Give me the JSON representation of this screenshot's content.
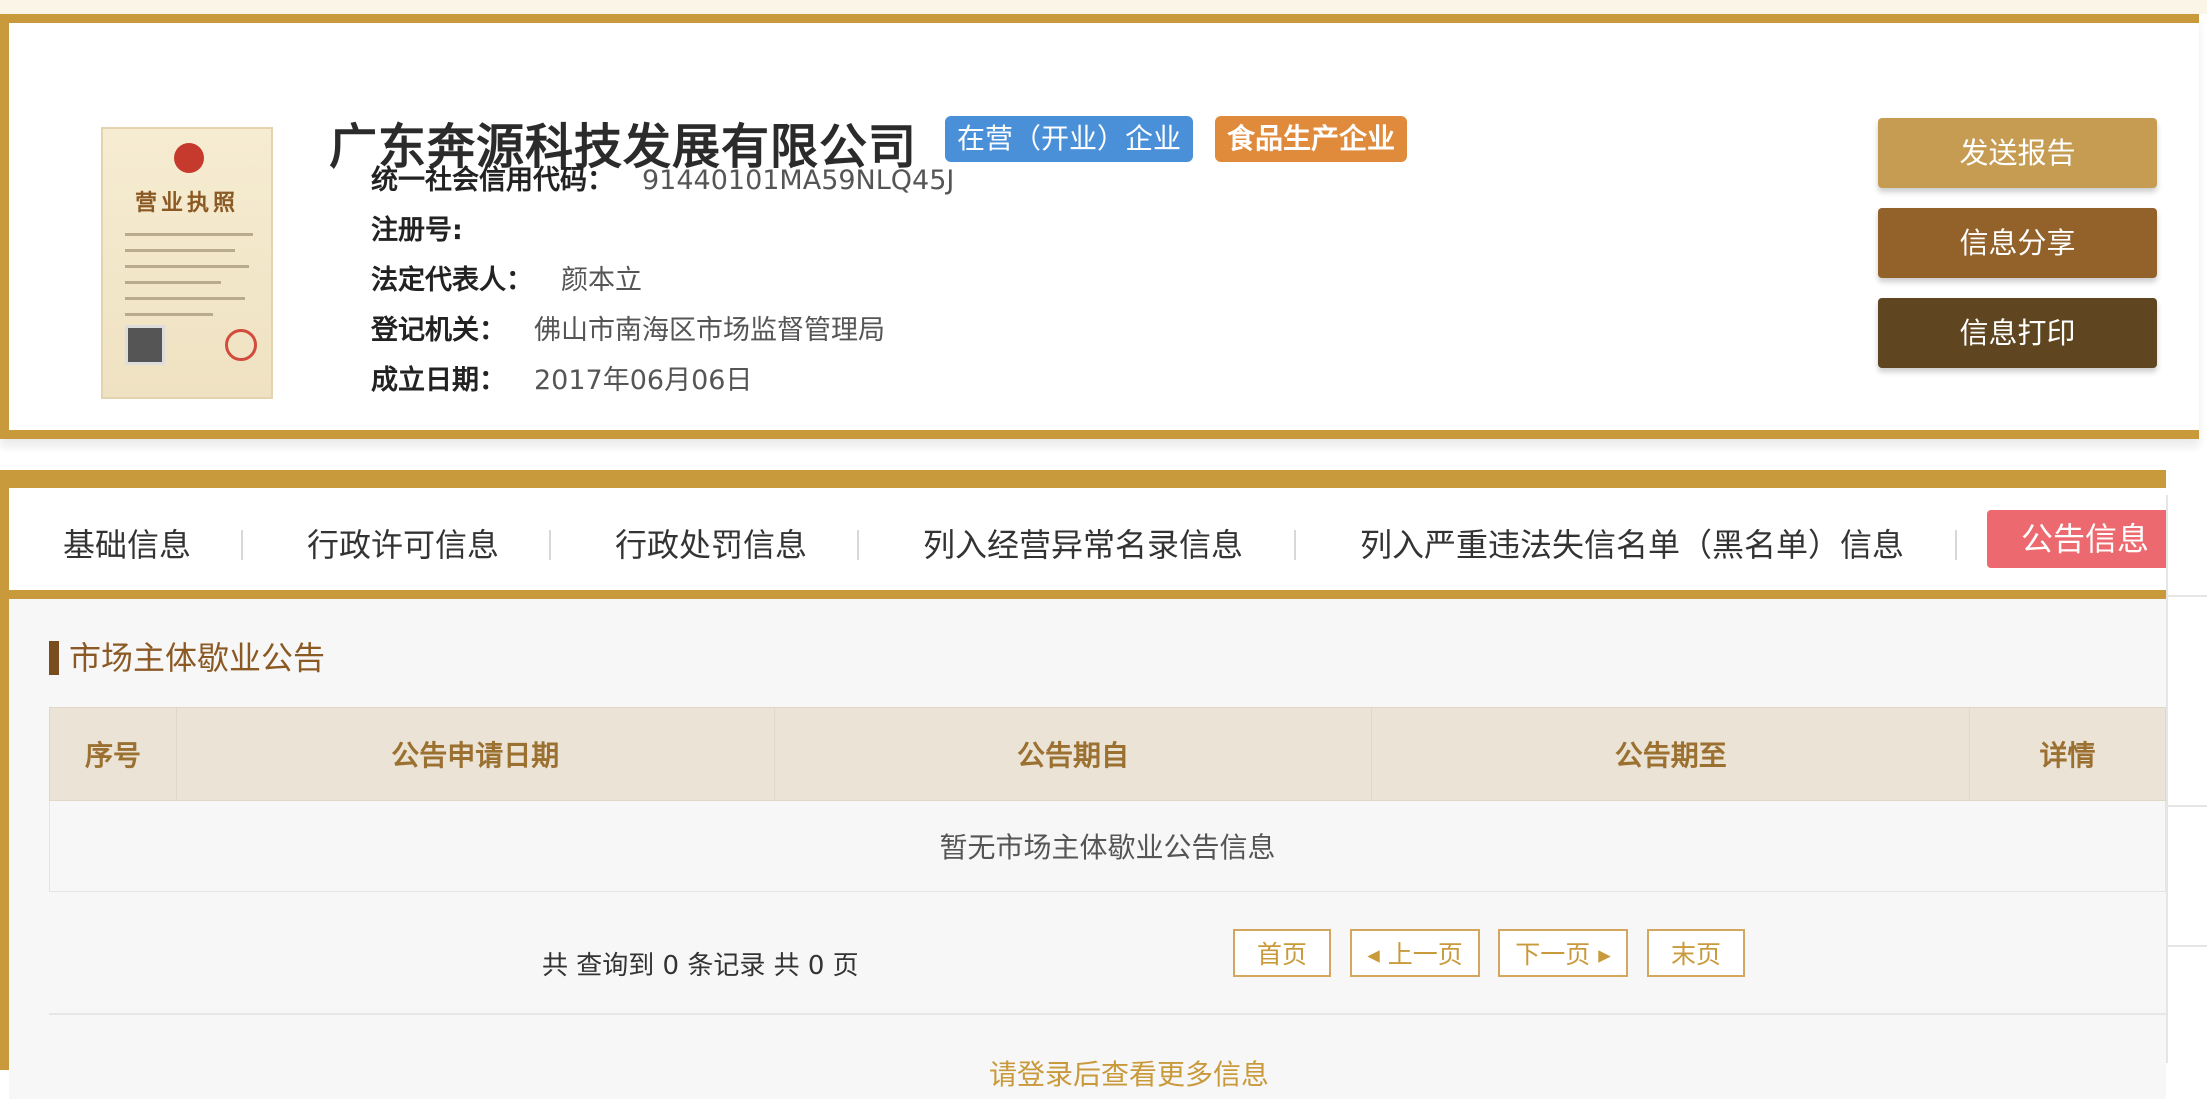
{
  "company": {
    "name": "广东奔源科技发展有限公司",
    "badges": {
      "status": "在营（开业）企业",
      "category": "食品生产企业"
    },
    "license_image": {
      "title": "营业执照"
    },
    "fields": {
      "credit_code": {
        "label": "统一社会信用代码：",
        "value": "91440101MA59NLQ45J"
      },
      "reg_no": {
        "label": "注册号:",
        "value": ""
      },
      "legal_rep": {
        "label": "法定代表人：",
        "value": "颜本立"
      },
      "authority": {
        "label": "登记机关：",
        "value": "佛山市南海区市场监督管理局"
      },
      "established": {
        "label": "成立日期：",
        "value": "2017年06月06日"
      }
    }
  },
  "actions": {
    "send_report": "发送报告",
    "share": "信息分享",
    "print": "信息打印"
  },
  "tabs": [
    "基础信息",
    "行政许可信息",
    "行政处罚信息",
    "列入经营异常名录信息",
    "列入严重违法失信名单（黑名单）信息",
    "公告信息"
  ],
  "active_tab": "公告信息",
  "section": {
    "title": "市场主体歇业公告",
    "columns": [
      "序号",
      "公告申请日期",
      "公告期自",
      "公告期至",
      "详情"
    ],
    "empty_message": "暂无市场主体歇业公告信息"
  },
  "pagination": {
    "summary": "共 查询到 0 条记录 共 0 页",
    "first": "首页",
    "prev": "上一页",
    "next": "下一页",
    "last": "末页"
  },
  "footer_partial_text": "请登录后查看更多信息",
  "colors": {
    "accent_gold": "#c99a3c",
    "badge_status": "#4a90d9",
    "badge_category": "#e08a3b",
    "active_tab": "#ec6a6f",
    "btn_send": "#c69c53",
    "btn_share": "#93612a",
    "btn_print": "#5f4620"
  }
}
